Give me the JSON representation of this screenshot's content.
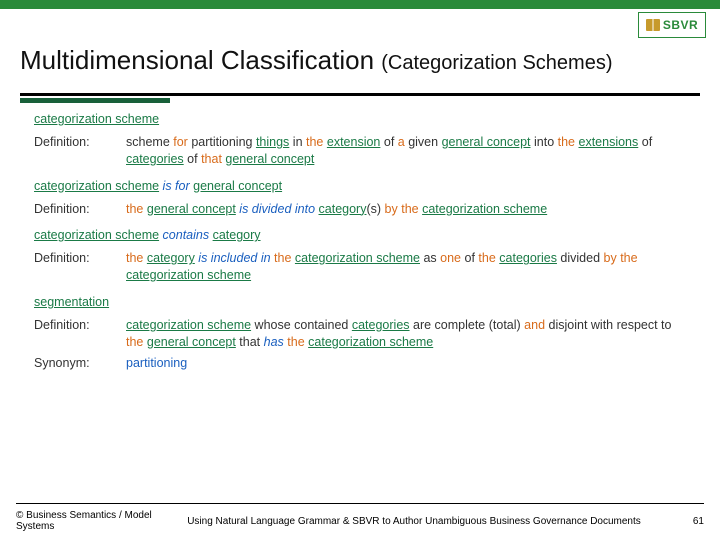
{
  "header": {
    "logo_text": "SBVR",
    "title_main": "Multidimensional Classification ",
    "title_paren": "(Categorization Schemes)"
  },
  "s1": {
    "head": "categorization scheme",
    "def_label": "Definition:",
    "d1a": "scheme ",
    "d1b": "for",
    "d1c": " partitioning ",
    "d1d": "things",
    "d1e": " in ",
    "d1f": "the",
    "d1g": " ",
    "d1h": "extension",
    "d1i": " of ",
    "d1j": "a",
    "d1k": " given ",
    "d1l": "general concept",
    "d1m": " into ",
    "d1n": "the",
    "d1o": " ",
    "d1p": "extensions",
    "d1q": " of ",
    "d1r": "categories",
    "d1s": " of ",
    "d1t": "that",
    "d1u": " ",
    "d1v": "general concept"
  },
  "s2": {
    "h1": "categorization scheme",
    "h2": " is for ",
    "h3": "general concept",
    "def_label": "Definition:",
    "d1": "the",
    "d2": " ",
    "d3": "general concept",
    "d4": " is divided into ",
    "d5": "category",
    "d6": "(s) ",
    "d7": "by",
    "d8": " ",
    "d9": "the",
    "d10": " ",
    "d11": "categorization scheme"
  },
  "s3": {
    "h1": "categorization scheme",
    "h2": " contains ",
    "h3": "category",
    "def_label": "Definition:",
    "d1": "the",
    "d2": " ",
    "d3": "category",
    "d4": " is included in ",
    "d5": "the",
    "d6": " ",
    "d7": "categorization scheme",
    "d8": " as ",
    "d9": "one",
    "d10": " of ",
    "d11": "the",
    "d12": " ",
    "d13": "categories",
    "d14": " divided ",
    "d15": "by",
    "d16": " ",
    "d17": "the",
    "d18": " ",
    "d19": "categorization scheme"
  },
  "s4": {
    "head": "segmentation",
    "def_label": "Definition:",
    "d1": "categorization scheme",
    "d2": " whose contained ",
    "d3": "categories",
    "d4": " are complete (total) ",
    "d5": "and",
    "d6": " disjoint with respect to ",
    "d7": "the",
    "d8": " ",
    "d9": "general concept",
    "d10": " that ",
    "d11": "has",
    "d12": " ",
    "d13": "the",
    "d14": " ",
    "d15": "categorization scheme",
    "syn_label": "Synonym:",
    "syn": "partitioning"
  },
  "footer": {
    "copyright": "© Business Semantics / Model Systems",
    "title": "Using Natural Language Grammar & SBVR to Author Unambiguous Business Governance Documents",
    "page": "61"
  }
}
